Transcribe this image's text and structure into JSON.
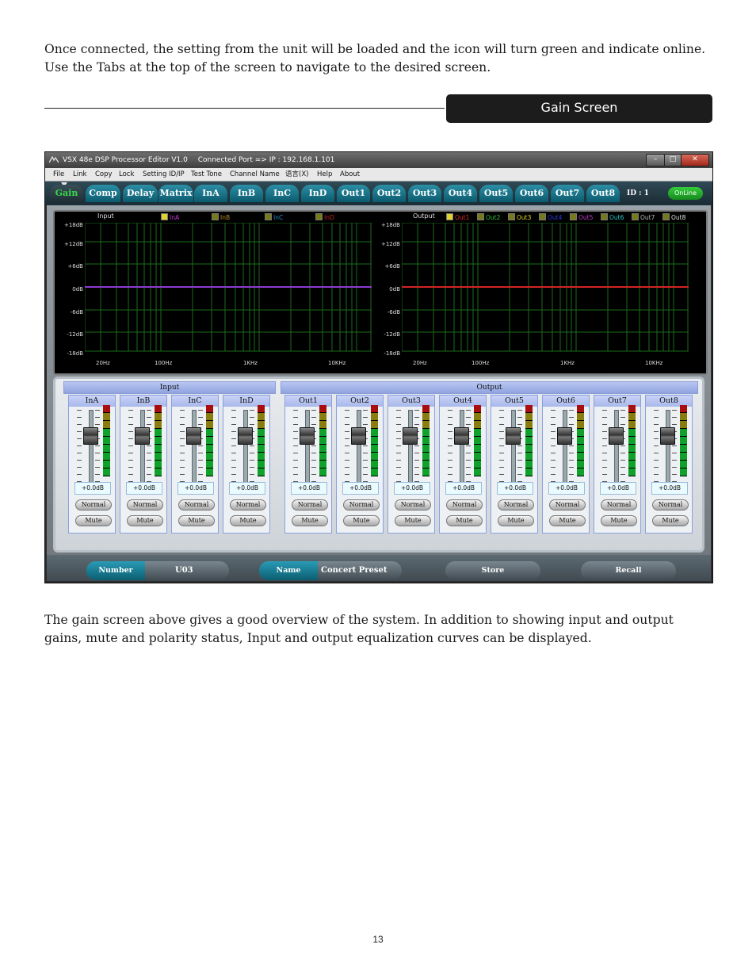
{
  "page": {
    "intro_text": "Once connected, the setting from the unit will be loaded and the icon will turn green and indicate online.  Use the Tabs at the top of the screen to navigate to the desired screen.",
    "section_title": "Gain Screen",
    "description_text": "The gain screen above gives a good overview of the system.  In addition to showing input and output gains, mute and polarity status, Input and output equalization curves can be displayed.",
    "page_number": "13"
  },
  "app": {
    "title": "VSX 48e DSP Processor Editor V1.0",
    "connection": "Connected Port => IP : 192.168.1.101",
    "window_buttons": [
      "–",
      "□",
      "✕"
    ],
    "menu": [
      "File",
      "Link",
      "Copy",
      "Lock",
      "Setting ID/IP",
      "Test Tone",
      "Channel Name",
      "语言(X)",
      "Help",
      "About"
    ],
    "tabs": [
      "Gain",
      "Comp",
      "Delay",
      "Matrix",
      "InA",
      "InB",
      "InC",
      "InD",
      "Out1",
      "Out2",
      "Out3",
      "Out4",
      "Out5",
      "Out6",
      "Out7",
      "Out8"
    ],
    "active_tab": "Gain",
    "device_id": "ID : 1",
    "status": "OnLine",
    "status_color": "#2ec936"
  },
  "graphs": {
    "input": {
      "title": "Input",
      "legend": [
        {
          "label": "InA",
          "color": "#c23ad0"
        },
        {
          "label": "InB",
          "color": "#b98a2a"
        },
        {
          "label": "InC",
          "color": "#2a8ac9"
        },
        {
          "label": "InD",
          "color": "#c0262a"
        }
      ],
      "curve_color": "#8d3bd0"
    },
    "output": {
      "title": "Output",
      "legend": [
        {
          "label": "Out1",
          "color": "#e02a2a"
        },
        {
          "label": "Out2",
          "color": "#29c33a"
        },
        {
          "label": "Out3",
          "color": "#e0d22a"
        },
        {
          "label": "Out4",
          "color": "#2a3ae0"
        },
        {
          "label": "Out5",
          "color": "#c23ad0"
        },
        {
          "label": "Out6",
          "color": "#2ac9c9"
        },
        {
          "label": "Out7",
          "color": "#b8b8b8"
        },
        {
          "label": "Out8",
          "color": "#e0e0e0"
        }
      ],
      "curve_color": "#d42424"
    },
    "y_labels": [
      "+18dB",
      "+12dB",
      "+6dB",
      "0dB",
      "-6dB",
      "-12dB",
      "-18dB"
    ],
    "x_labels": [
      "20Hz",
      "100Hz",
      "1KHz",
      "10KHz"
    ]
  },
  "mixer": {
    "input_group": "Input",
    "output_group": "Output",
    "input_channels": [
      {
        "name": "InA",
        "gain": "+0.0dB",
        "polarity": "Normal",
        "mute": "Mute"
      },
      {
        "name": "InB",
        "gain": "+0.0dB",
        "polarity": "Normal",
        "mute": "Mute"
      },
      {
        "name": "InC",
        "gain": "+0.0dB",
        "polarity": "Normal",
        "mute": "Mute"
      },
      {
        "name": "InD",
        "gain": "+0.0dB",
        "polarity": "Normal",
        "mute": "Mute"
      }
    ],
    "output_channels": [
      {
        "name": "Out1",
        "gain": "+0.0dB",
        "polarity": "Normal",
        "mute": "Mute"
      },
      {
        "name": "Out2",
        "gain": "+0.0dB",
        "polarity": "Normal",
        "mute": "Mute"
      },
      {
        "name": "Out3",
        "gain": "+0.0dB",
        "polarity": "Normal",
        "mute": "Mute"
      },
      {
        "name": "Out4",
        "gain": "+0.0dB",
        "polarity": "Normal",
        "mute": "Mute"
      },
      {
        "name": "Out5",
        "gain": "+0.0dB",
        "polarity": "Normal",
        "mute": "Mute"
      },
      {
        "name": "Out6",
        "gain": "+0.0dB",
        "polarity": "Normal",
        "mute": "Mute"
      },
      {
        "name": "Out7",
        "gain": "+0.0dB",
        "polarity": "Normal",
        "mute": "Mute"
      },
      {
        "name": "Out8",
        "gain": "+0.0dB",
        "polarity": "Normal",
        "mute": "Mute"
      }
    ]
  },
  "preset_bar": {
    "number_label": "Number",
    "number_value": "U03",
    "name_label": "Name",
    "name_value": "Concert Preset",
    "store_label": "Store",
    "recall_label": "Recall"
  }
}
